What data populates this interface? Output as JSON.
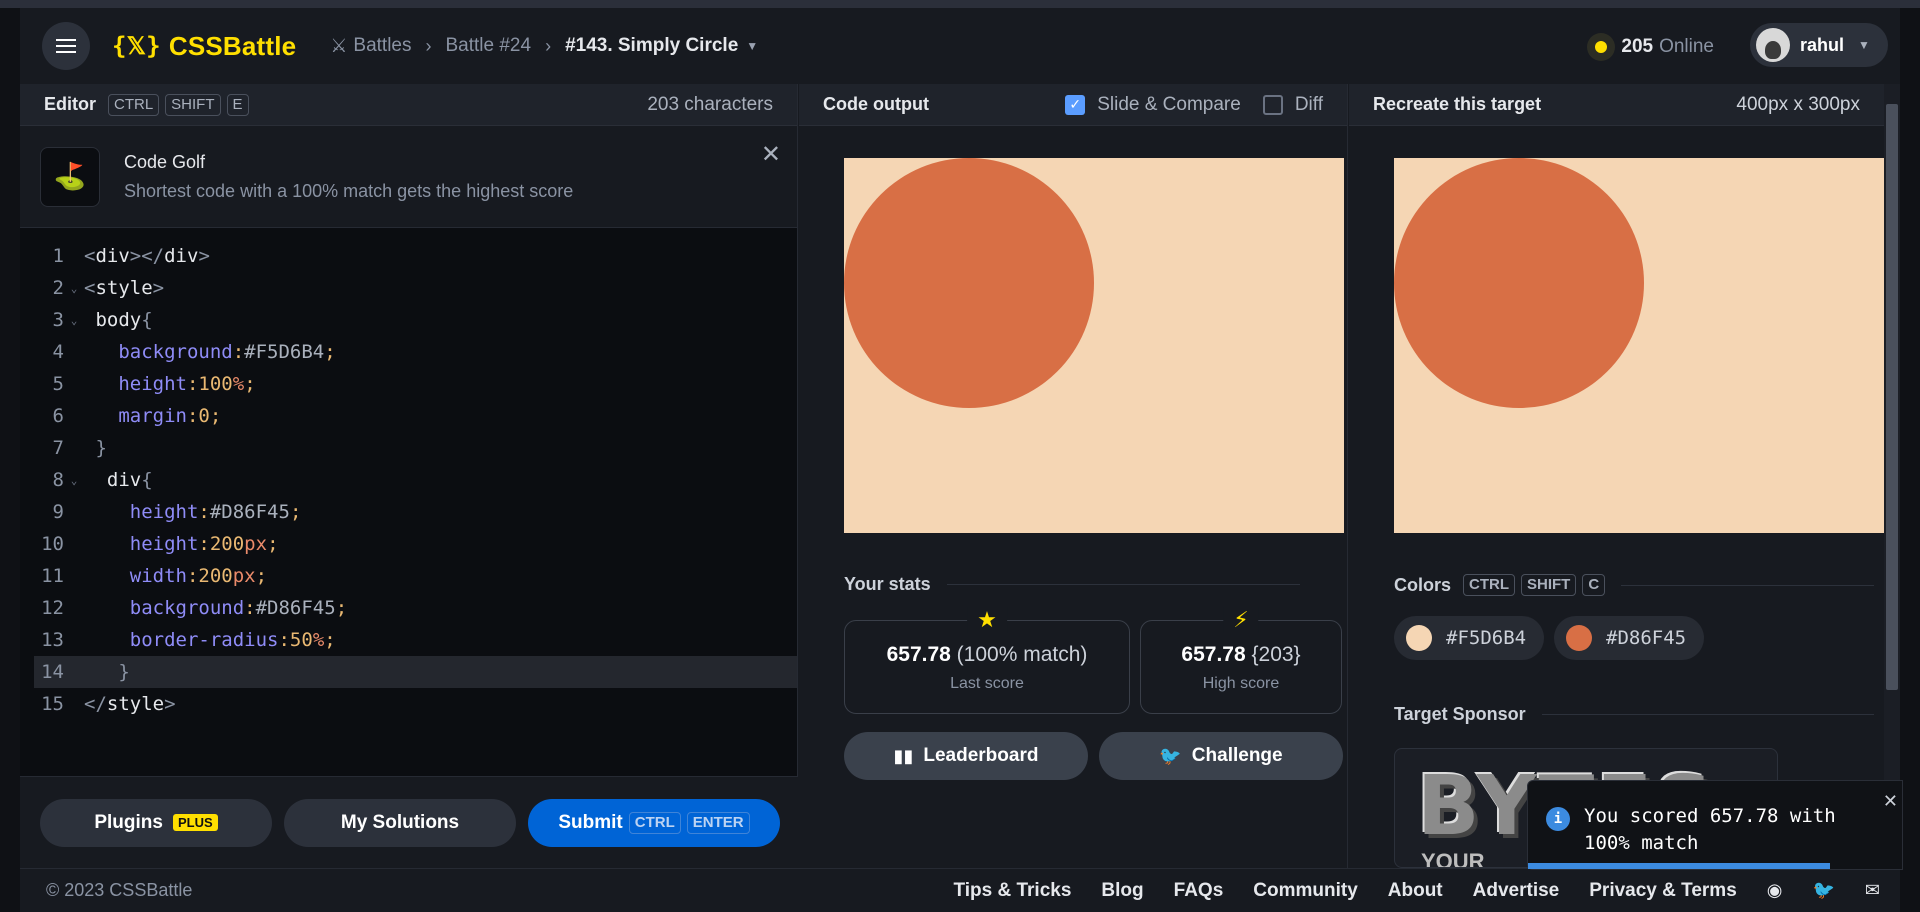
{
  "header": {
    "logo_mark": "{𝕏}",
    "logo_text": "CSSBattle",
    "breadcrumbs": [
      "Battles",
      "Battle #24",
      "#143. Simply Circle"
    ],
    "online_count": "205",
    "online_label": "Online",
    "user_name": "rahul"
  },
  "editor": {
    "title": "Editor",
    "shortcut": [
      "CTRL",
      "SHIFT",
      "E"
    ],
    "char_count": "203 characters",
    "golf_title": "Code Golf",
    "golf_subtitle": "Shortest code with a 100% match gets the highest score",
    "line_numbers": [
      "1",
      "2",
      "3",
      "4",
      "5",
      "6",
      "7",
      "8",
      "9",
      "10",
      "11",
      "12",
      "13",
      "14",
      "15"
    ]
  },
  "editor_footer": {
    "plugins_label": "Plugins",
    "plugins_badge": "PLUS",
    "solutions_label": "My Solutions",
    "submit_label": "Submit",
    "submit_keys": [
      "CTRL",
      "ENTER"
    ]
  },
  "output": {
    "title": "Code output",
    "slide_compare_label": "Slide & Compare",
    "slide_compare_checked": true,
    "diff_label": "Diff",
    "diff_checked": false,
    "stats_title": "Your stats",
    "last_score": "657.78",
    "last_score_detail": "(100% match)",
    "last_score_label": "Last score",
    "high_score": "657.78",
    "high_score_detail": "{203}",
    "high_score_label": "High score",
    "leaderboard_label": "Leaderboard",
    "challenge_label": "Challenge"
  },
  "target": {
    "title": "Recreate this target",
    "size": "400px x 300px",
    "colors_title": "Colors",
    "colors_shortcut": [
      "CTRL",
      "SHIFT",
      "C"
    ],
    "colors": [
      {
        "hex": "#F5D6B4",
        "label": "#F5D6B4"
      },
      {
        "hex": "#D86F45",
        "label": "#D86F45"
      }
    ],
    "sponsor_title": "Target Sponsor",
    "sponsor_logo": "BYTES",
    "sponsor_sub": "YOUR"
  },
  "toast": {
    "message": "You scored 657.78 with 100% match"
  },
  "footer": {
    "copyright": "© 2023 CSSBattle",
    "links": [
      "Tips & Tricks",
      "Blog",
      "FAQs",
      "Community",
      "About",
      "Advertise",
      "Privacy & Terms"
    ]
  },
  "icons": {
    "menu": "menu-icon",
    "swords": "swords-icon",
    "star": "star-icon",
    "bolt": "bolt-icon",
    "leaderboard": "bar-chart-icon",
    "twitter": "twitter-icon",
    "discord": "discord-icon",
    "mail": "mail-icon",
    "info": "info-icon",
    "close": "close-icon"
  },
  "colors": {
    "accent": "#ffdf00",
    "submit": "#0064d6",
    "canvas_bg": "#F5D6B4",
    "circle": "#D86F45"
  }
}
